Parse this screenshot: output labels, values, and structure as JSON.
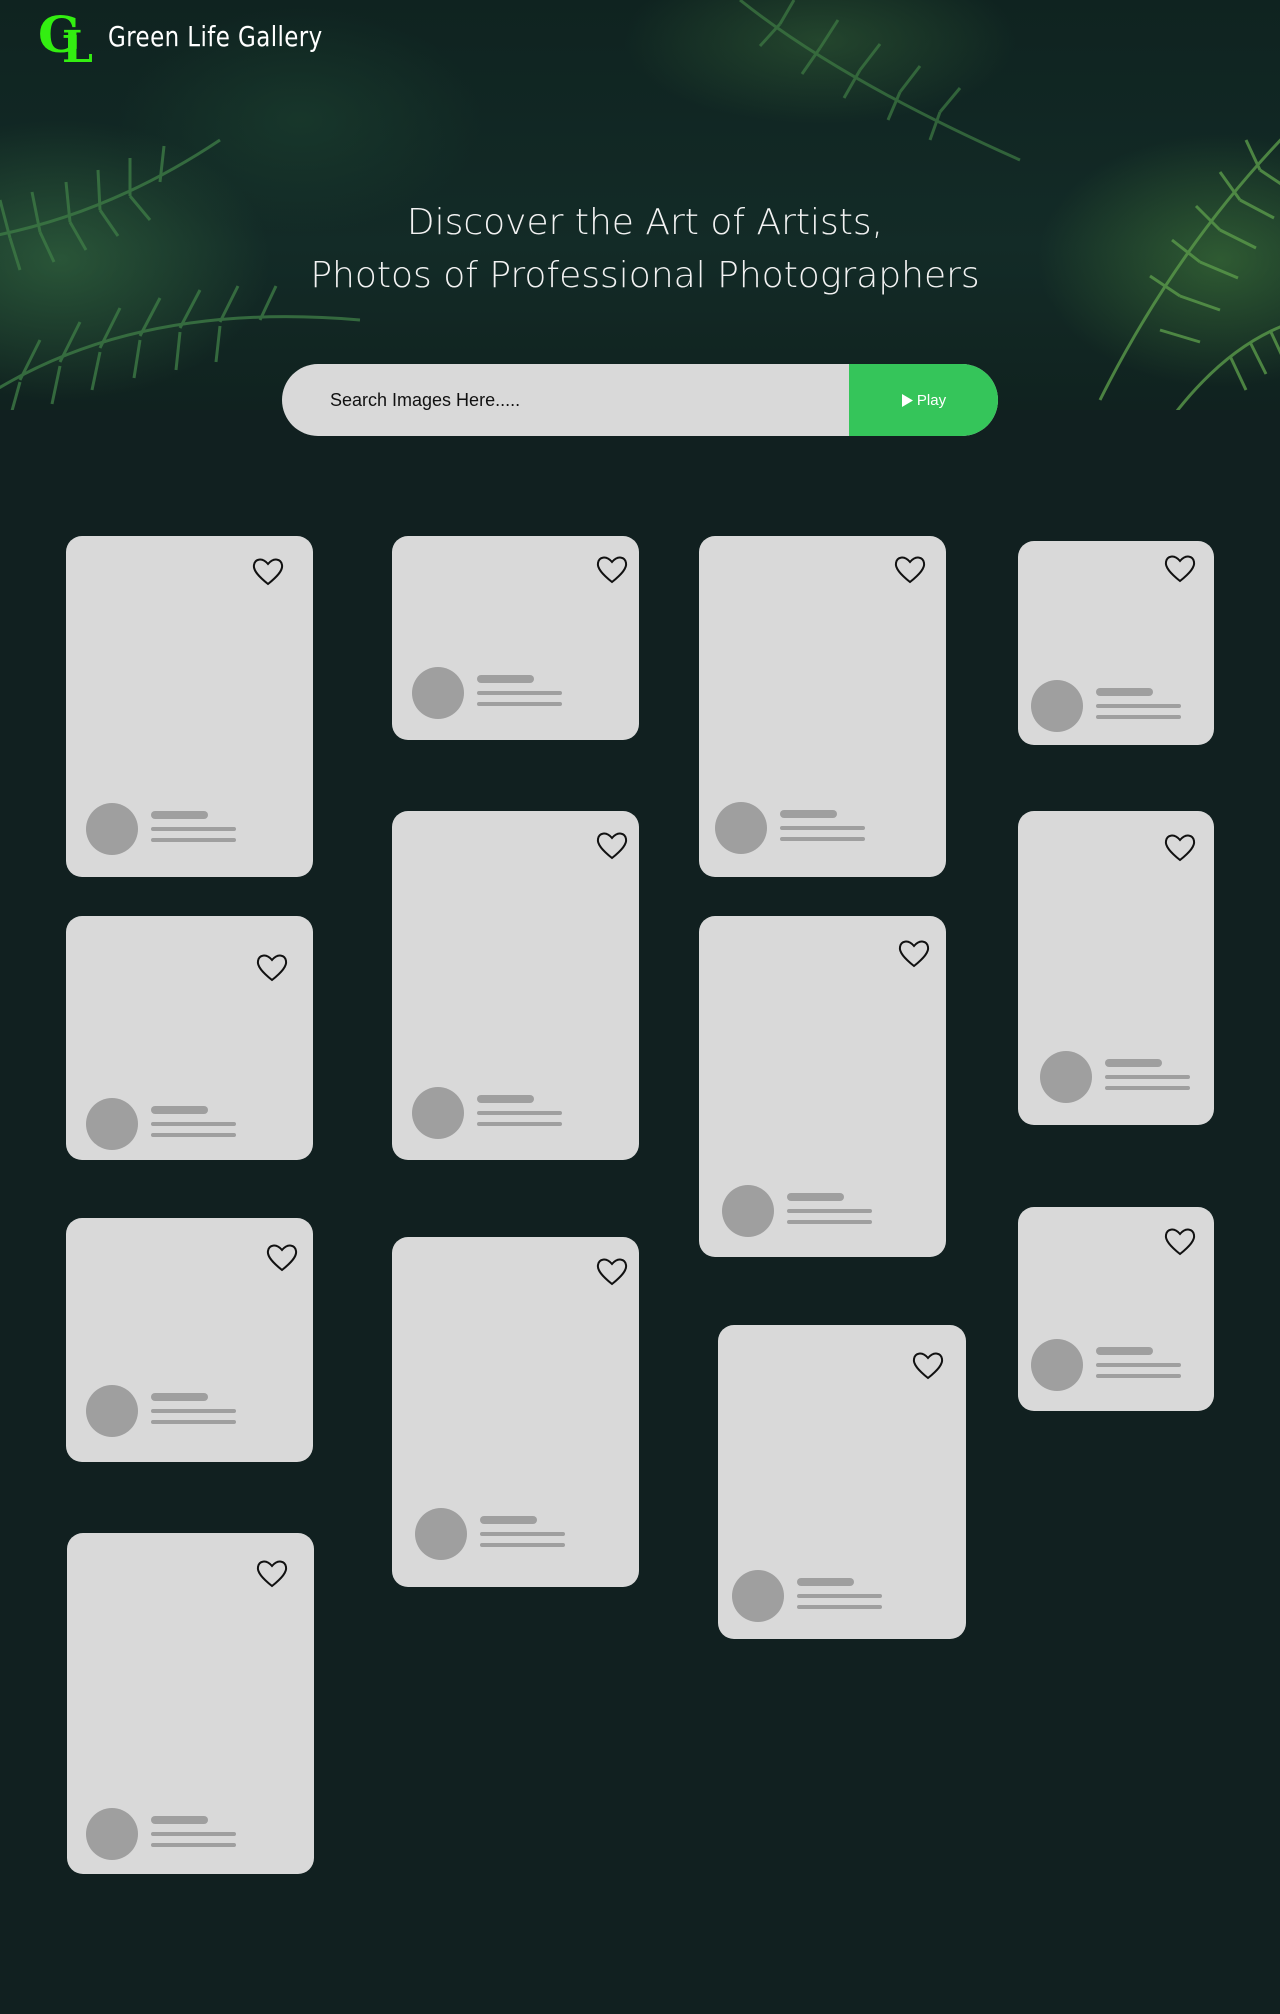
{
  "brand": {
    "name": "Green Life Gallery",
    "logo_letters": "GL",
    "logo_color": "#33ee11"
  },
  "hero": {
    "headline_line1": "Discover the Art of Artists,",
    "headline_line2": "Photos of Professional Photographers"
  },
  "search": {
    "placeholder": "Search Images Here.....",
    "button_label": "Play",
    "button_icon": "play-icon",
    "accent": "#35c55a"
  },
  "colors": {
    "background": "#112020",
    "card": "#d9d9d9",
    "skeleton": "#9f9f9f"
  },
  "cards": [
    {
      "id": 1,
      "icon": "heart-icon"
    },
    {
      "id": 2,
      "icon": "heart-icon"
    },
    {
      "id": 3,
      "icon": "heart-icon"
    },
    {
      "id": 4,
      "icon": "heart-icon"
    },
    {
      "id": 5,
      "icon": "heart-icon"
    },
    {
      "id": 6,
      "icon": "heart-icon"
    },
    {
      "id": 7,
      "icon": "heart-icon"
    },
    {
      "id": 8,
      "icon": "heart-icon"
    },
    {
      "id": 9,
      "icon": "heart-icon"
    },
    {
      "id": 10,
      "icon": "heart-icon"
    },
    {
      "id": 11,
      "icon": "heart-icon"
    },
    {
      "id": 12,
      "icon": "heart-icon"
    },
    {
      "id": 13,
      "icon": "heart-icon"
    }
  ]
}
